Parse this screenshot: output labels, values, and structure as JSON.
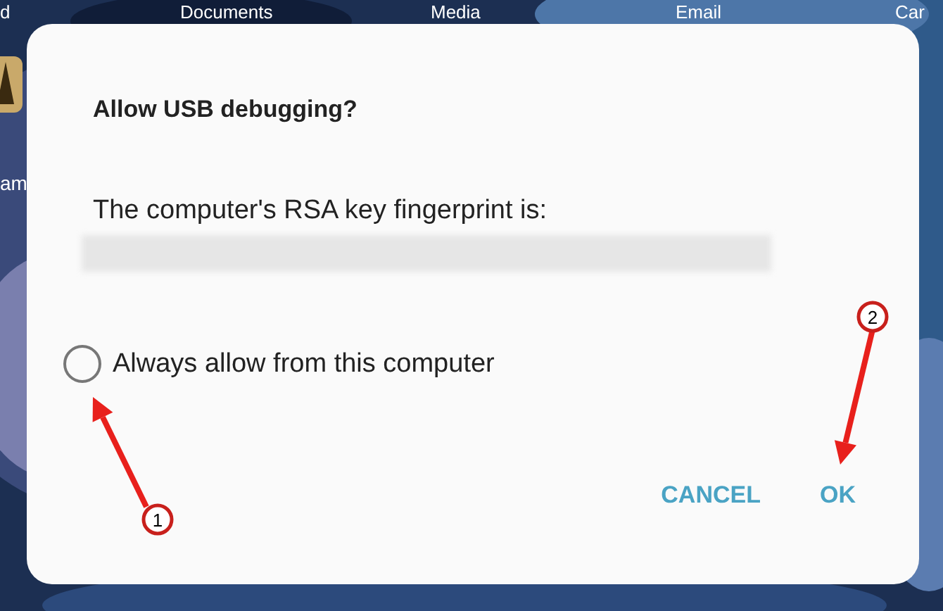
{
  "desktop": {
    "app_labels": [
      "d",
      "Documents",
      "Media",
      "Email",
      "Car"
    ],
    "side_app_label": "am"
  },
  "dialog": {
    "title": "Allow USB debugging?",
    "message": "The computer's RSA key fingerprint is:",
    "option": {
      "label": "Always allow from this computer",
      "checked": false
    },
    "buttons": [
      "CANCEL",
      "OK"
    ]
  },
  "annotations": [
    {
      "label": "1"
    },
    {
      "label": "2"
    }
  ]
}
